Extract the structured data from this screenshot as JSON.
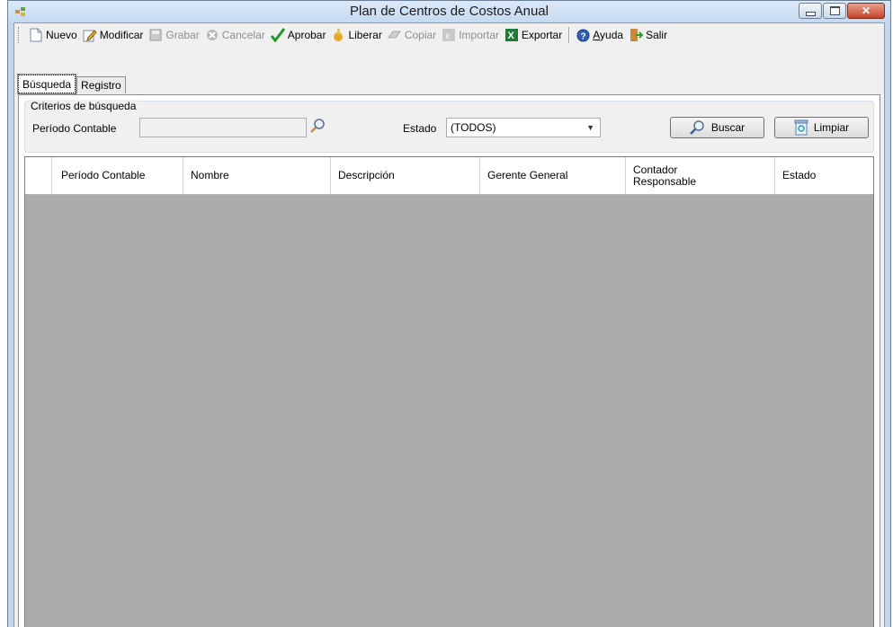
{
  "window": {
    "title": "Plan de Centros de Costos Anual"
  },
  "toolbar": {
    "items": [
      {
        "label": "Nuevo",
        "icon": "new-document-icon",
        "enabled": true
      },
      {
        "label": "Modificar",
        "icon": "edit-icon",
        "enabled": true
      },
      {
        "label": "Grabar",
        "icon": "save-icon",
        "enabled": false
      },
      {
        "label": "Cancelar",
        "icon": "cancel-icon",
        "enabled": false
      },
      {
        "label": "Aprobar",
        "icon": "checkmark-icon",
        "enabled": true
      },
      {
        "label": "Liberar",
        "icon": "release-icon",
        "enabled": true
      },
      {
        "label": "Copiar",
        "icon": "copy-icon",
        "enabled": false
      },
      {
        "label": "Importar",
        "icon": "import-icon",
        "enabled": false
      },
      {
        "label": "Exportar",
        "icon": "excel-icon",
        "enabled": true
      },
      {
        "label_pre": "",
        "label_ul": "A",
        "label_post": "yuda",
        "icon": "help-icon",
        "enabled": true
      },
      {
        "label": "Salir",
        "icon": "exit-icon",
        "enabled": true
      }
    ]
  },
  "tabs": [
    {
      "label": "Búsqueda",
      "active": true
    },
    {
      "label": "Registro",
      "active": false
    }
  ],
  "search": {
    "group_title": "Criterios de búsqueda",
    "periodo_label": "Período Contable",
    "periodo_value": "",
    "estado_label": "Estado",
    "estado_value": "(TODOS)",
    "buscar_label": "Buscar",
    "limpiar_label": "Limpiar"
  },
  "grid": {
    "columns": [
      {
        "label": "Período Contable"
      },
      {
        "label": "Nombre"
      },
      {
        "label": "Descripción"
      },
      {
        "label": "Gerente General"
      },
      {
        "label": "Contador\nResponsable"
      },
      {
        "label": "Estado"
      }
    ],
    "rows": []
  },
  "colors": {
    "grid_background": "#ababab",
    "title_bar": "#c5d9f0",
    "close_button": "#c6432b"
  }
}
